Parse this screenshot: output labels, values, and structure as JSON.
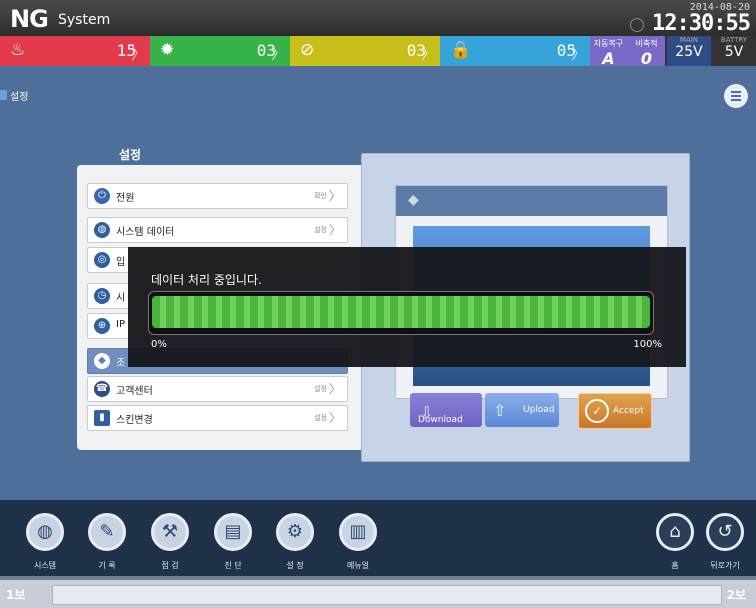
{
  "header": {
    "logo_mark": "NG",
    "logo_text": "System",
    "date": "2014-08-20",
    "time": "12:30:55"
  },
  "status": {
    "segments": [
      {
        "icon": "fire-icon",
        "glyph": "♨",
        "count": "15",
        "color": "#e23a4a"
      },
      {
        "icon": "gear-icon",
        "glyph": "✹",
        "count": "03",
        "color": "#37b34a"
      },
      {
        "icon": "prohibited-icon",
        "glyph": "⊘",
        "count": "03",
        "color": "#c8bf1a"
      },
      {
        "icon": "lock-icon",
        "glyph": "🔒",
        "count": "05",
        "color": "#36a3db"
      }
    ],
    "auto_restore": {
      "label": "자동복구",
      "value": "A"
    },
    "broadcast": {
      "label": "비축적",
      "value": "0"
    },
    "main": {
      "label": "MAIN",
      "value": "25V"
    },
    "battery": {
      "label": "BATTRY",
      "value": "5V"
    }
  },
  "breadcrumb": "설정",
  "settings": {
    "tab": "설정",
    "rows": [
      {
        "icon": "plug-icon",
        "glyph": "⏻",
        "label": "전원",
        "action": "확인"
      },
      {
        "icon": "globe-icon",
        "glyph": "◍",
        "label": "시스템 데이터",
        "action": "설정"
      },
      {
        "icon": "compass-icon",
        "glyph": "◎",
        "label": "입",
        "action": ""
      },
      {
        "icon": "clock-icon",
        "glyph": "◷",
        "label": "시",
        "action": ""
      },
      {
        "icon": "crosshair-icon",
        "glyph": "⊕",
        "label": "IP",
        "action": ""
      },
      {
        "icon": "cube-icon",
        "glyph": "◆",
        "label": "조",
        "action": ""
      },
      {
        "icon": "phone-icon",
        "glyph": "☎",
        "label": "고객센터",
        "action": "설정"
      },
      {
        "icon": "book-icon",
        "glyph": "▮",
        "label": "스킨변경",
        "action": "설정"
      }
    ]
  },
  "skin_buttons": {
    "download": "Download",
    "upload": "Upload",
    "accept": "Accept"
  },
  "progress": {
    "message": "데이터 처리 중입니다.",
    "percent": 100,
    "min_label": "0%",
    "max_label": "100%"
  },
  "dock": {
    "items": [
      {
        "icon": "globe-icon",
        "glyph": "◍",
        "label": "시스템"
      },
      {
        "icon": "pencil-icon",
        "glyph": "✎",
        "label": "기 록"
      },
      {
        "icon": "test-icon",
        "glyph": "⚒",
        "label": "점 검"
      },
      {
        "icon": "clipboard-icon",
        "glyph": "▤",
        "label": "진 단"
      },
      {
        "icon": "gear-icon",
        "glyph": "⚙",
        "label": "설 정"
      },
      {
        "icon": "manual-icon",
        "glyph": "▥",
        "label": "메뉴얼"
      }
    ],
    "home_label": "홈",
    "back_label": "뒤로가기"
  },
  "footer": {
    "left": "1보",
    "right": "2보"
  }
}
